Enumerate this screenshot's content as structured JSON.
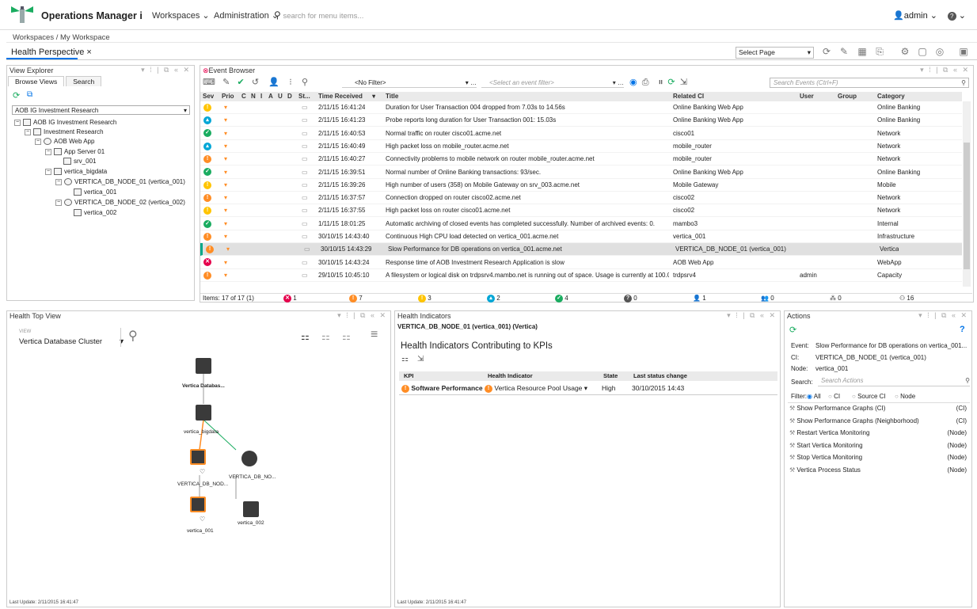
{
  "app": {
    "title": "Operations Manager i",
    "nav": [
      "Workspaces",
      "Administration"
    ],
    "search_placeholder": "search for menu items...",
    "user": "admin",
    "help": "?"
  },
  "breadcrumb": "Workspaces / My Workspace",
  "perspective_tab": "Health Perspective ×",
  "select_page": "Select Page",
  "view_explorer": {
    "title": "View Explorer",
    "tabs": [
      "Browse Views",
      "Search"
    ],
    "selected_view": "AOB IG Investment Research",
    "tree": [
      "AOB IG Investment Research",
      "Investment Research",
      "AOB Web App",
      "App Server 01",
      "srv_001",
      "vertica_bigdata",
      "VERTICA_DB_NODE_01 (vertica_001)",
      "vertica_001",
      "VERTICA_DB_NODE_02 (vertica_002)",
      "vertica_002"
    ]
  },
  "event_browser": {
    "title": "Event Browser",
    "no_filter": "<No Filter>",
    "event_filter_placeholder": "<Select an event filter>",
    "search_placeholder": "Search Events (Ctrl+F)",
    "columns": [
      "Sev",
      "Prio",
      "C",
      "N",
      "I",
      "A",
      "U",
      "D",
      "St...",
      "Time Received",
      "Title",
      "Related CI",
      "User",
      "Group",
      "Category"
    ],
    "rows": [
      {
        "sev": "warning",
        "time": "2/11/15 16:41:24",
        "title": "Duration for User Transaction 004 dropped from 7.03s to 14.56s",
        "ci": "Online Banking Web App",
        "user": "",
        "cat": "Online Banking"
      },
      {
        "sev": "minor",
        "time": "2/11/15 16:41:23",
        "title": "Probe reports long duration for User Transaction 001: 15.03s",
        "ci": "Online Banking Web App",
        "user": "",
        "cat": "Online Banking"
      },
      {
        "sev": "normal",
        "time": "2/11/15 16:40:53",
        "title": "Normal traffic on router cisco01.acme.net",
        "ci": "cisco01",
        "user": "",
        "cat": "Network"
      },
      {
        "sev": "minor",
        "time": "2/11/15 16:40:49",
        "title": "High packet loss on mobile_router.acme.net",
        "ci": "mobile_router",
        "user": "",
        "cat": "Network"
      },
      {
        "sev": "major",
        "time": "2/11/15 16:40:27",
        "title": "Connectivity problems to mobile network on router mobile_router.acme.net",
        "ci": "mobile_router",
        "user": "",
        "cat": "Network"
      },
      {
        "sev": "normal",
        "time": "2/11/15 16:39:51",
        "title": "Normal number of Online Banking transactions: 93/sec.",
        "ci": "Online Banking Web App",
        "user": "",
        "cat": "Online Banking"
      },
      {
        "sev": "warning",
        "time": "2/11/15 16:39:26",
        "title": "High number of users (358) on Mobile Gateway on srv_003.acme.net",
        "ci": "Mobile Gateway",
        "user": "",
        "cat": "Mobile"
      },
      {
        "sev": "major",
        "time": "2/11/15 16:37:57",
        "title": "Connection dropped on router cisco02.acme.net",
        "ci": "cisco02",
        "user": "",
        "cat": "Network"
      },
      {
        "sev": "warning",
        "time": "2/11/15 16:37:55",
        "title": "High packet loss on router cisco01.acme.net",
        "ci": "cisco02",
        "user": "",
        "cat": "Network"
      },
      {
        "sev": "normal",
        "time": "1/11/15 18:01:25",
        "title": "Automatic archiving of closed events has completed successfully. Number of archived events: 0.",
        "ci": "mambo3",
        "user": "",
        "cat": "Internal"
      },
      {
        "sev": "major",
        "time": "30/10/15 14:43:40",
        "title": "Continuous High CPU load detected on vertica_001.acme.net",
        "ci": "vertica_001",
        "user": "",
        "cat": "Infrastructure"
      },
      {
        "sev": "major",
        "time": "30/10/15 14:43:29",
        "title": "Slow Performance for DB operations on vertica_001.acme.net",
        "ci": "VERTICA_DB_NODE_01 (vertica_001)",
        "user": "",
        "cat": "Vertica",
        "selected": true
      },
      {
        "sev": "critical",
        "time": "30/10/15 14:43:24",
        "title": "Response time of AOB Investment Research Application is slow",
        "ci": "AOB Web App",
        "user": "",
        "cat": "WebApp"
      },
      {
        "sev": "major",
        "time": "29/10/15 10:45:10",
        "title": "A filesystem or logical disk on trdpsrv4.mambo.net is running out of space. Usage is currently at 100.0",
        "ci": "trdpsrv4",
        "user": "admin",
        "cat": "Capacity"
      }
    ],
    "footer": {
      "items": "Items: 17 of 17 (1)",
      "critical": "1",
      "major": "7",
      "warning": "3",
      "minor": "2",
      "normal": "4",
      "unknown": "0",
      "a": "1",
      "b": "0",
      "c": "0",
      "d": "16"
    }
  },
  "health_top_view": {
    "title": "Health Top View",
    "view_label": "VIEW",
    "view": "Vertica Database Cluster",
    "nodes": [
      "Vertica Databas...",
      "vertica_bigdata",
      "VERTICA_DB_NOD...",
      "VERTICA_DB_NO...",
      "vertica_001",
      "vertica_002"
    ],
    "last_update": "Last Update: 2/11/2015 16:41:47"
  },
  "health_indicators": {
    "title": "Health Indicators",
    "ci": "VERTICA_DB_NODE_01 (vertica_001) (Vertica)",
    "subtitle": "Health Indicators Contributing to KPIs",
    "columns": [
      "KPI",
      "Health Indicator",
      "State",
      "Last status change"
    ],
    "row": {
      "kpi": "Software Performance",
      "hi": "Vertica Resource Pool Usage",
      "state": "High",
      "changed": "30/10/2015 14:43"
    },
    "last_update": "Last Update: 2/11/2015 16:41:47"
  },
  "actions": {
    "title": "Actions",
    "event_label": "Event:",
    "event": "Slow Performance for DB operations on vertica_001...",
    "ci_label": "CI:",
    "ci": "VERTICA_DB_NODE_01 (vertica_001)",
    "node_label": "Node:",
    "node": "vertica_001",
    "search_label": "Search:",
    "search_placeholder": "Search Actions",
    "filter_label": "Filter:",
    "filters": [
      "All",
      "CI",
      "Source CI",
      "Node"
    ],
    "items": [
      {
        "label": "Show Performance Graphs (CI)",
        "scope": "(CI)"
      },
      {
        "label": "Show Performance Graphs (Neighborhood)",
        "scope": "(CI)"
      },
      {
        "label": "Restart Vertica Monitoring",
        "scope": "(Node)"
      },
      {
        "label": "Start Vertica Monitoring",
        "scope": "(Node)"
      },
      {
        "label": "Stop Vertica Monitoring",
        "scope": "(Node)"
      },
      {
        "label": "Vertica Process Status",
        "scope": "(Node)"
      }
    ]
  },
  "colors": {
    "critical": "#e5004c",
    "major": "#ff8d25",
    "warning": "#ffc400",
    "minor": "#00a6d6",
    "normal": "#1aac60",
    "unknown": "#555555",
    "accent": "#0073e7"
  }
}
